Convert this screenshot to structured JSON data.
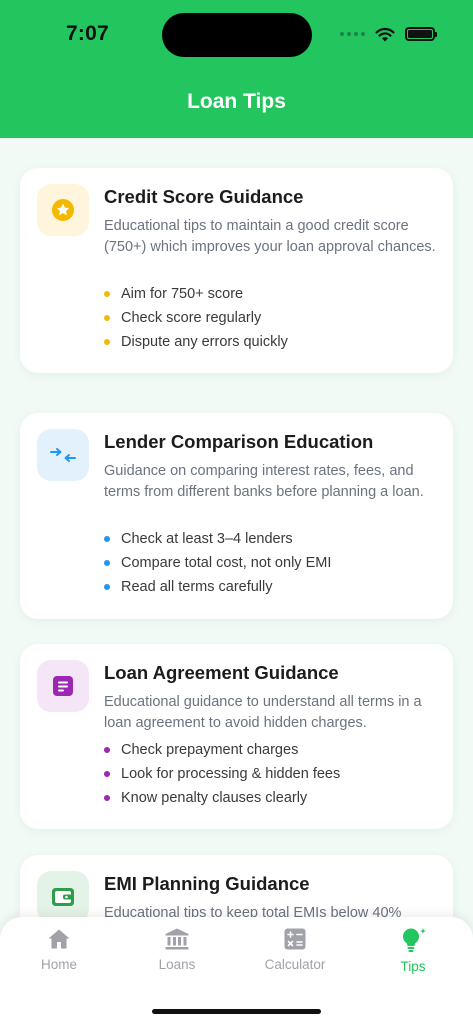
{
  "status": {
    "time": "7:07"
  },
  "header": {
    "title": "Loan Tips"
  },
  "cards": [
    {
      "title": "Credit Score Guidance",
      "description": "Educational tips to maintain a good credit score (750+) which improves your loan approval chances.",
      "bullets": [
        "Aim for 750+ score",
        "Check score regularly",
        "Dispute any errors quickly"
      ],
      "icon": "star-icon",
      "accent": "#f5b800",
      "icon_bg": "#fff5dc"
    },
    {
      "title": "Lender Comparison Education",
      "description": "Guidance on comparing interest rates, fees, and terms from different banks before planning a loan.",
      "bullets": [
        "Check at least 3–4 lenders",
        "Compare total cost, not only EMI",
        "Read all terms carefully"
      ],
      "icon": "compare-arrows-icon",
      "accent": "#2196f3",
      "icon_bg": "#e3f1fd"
    },
    {
      "title": "Loan Agreement Guidance",
      "description": "Educational guidance to understand all terms in a loan agreement to avoid hidden charges.",
      "bullets": [
        "Check prepayment charges",
        "Look for processing & hidden fees",
        "Know penalty clauses clearly"
      ],
      "icon": "document-icon",
      "accent": "#9c27b0",
      "icon_bg": "#f4e5f7"
    },
    {
      "title": "EMI Planning Guidance",
      "description": "Educational tips to keep total EMIs below 40%",
      "icon": "wallet-icon",
      "accent": "#2e9e4a",
      "icon_bg": "#e4f3e8"
    }
  ],
  "tabbar": {
    "active": "Tips",
    "active_color": "#22c55e",
    "items": [
      {
        "label": "Home",
        "icon": "home-icon"
      },
      {
        "label": "Loans",
        "icon": "bank-icon"
      },
      {
        "label": "Calculator",
        "icon": "calculator-icon"
      },
      {
        "label": "Tips",
        "icon": "lightbulb-icon"
      }
    ]
  }
}
